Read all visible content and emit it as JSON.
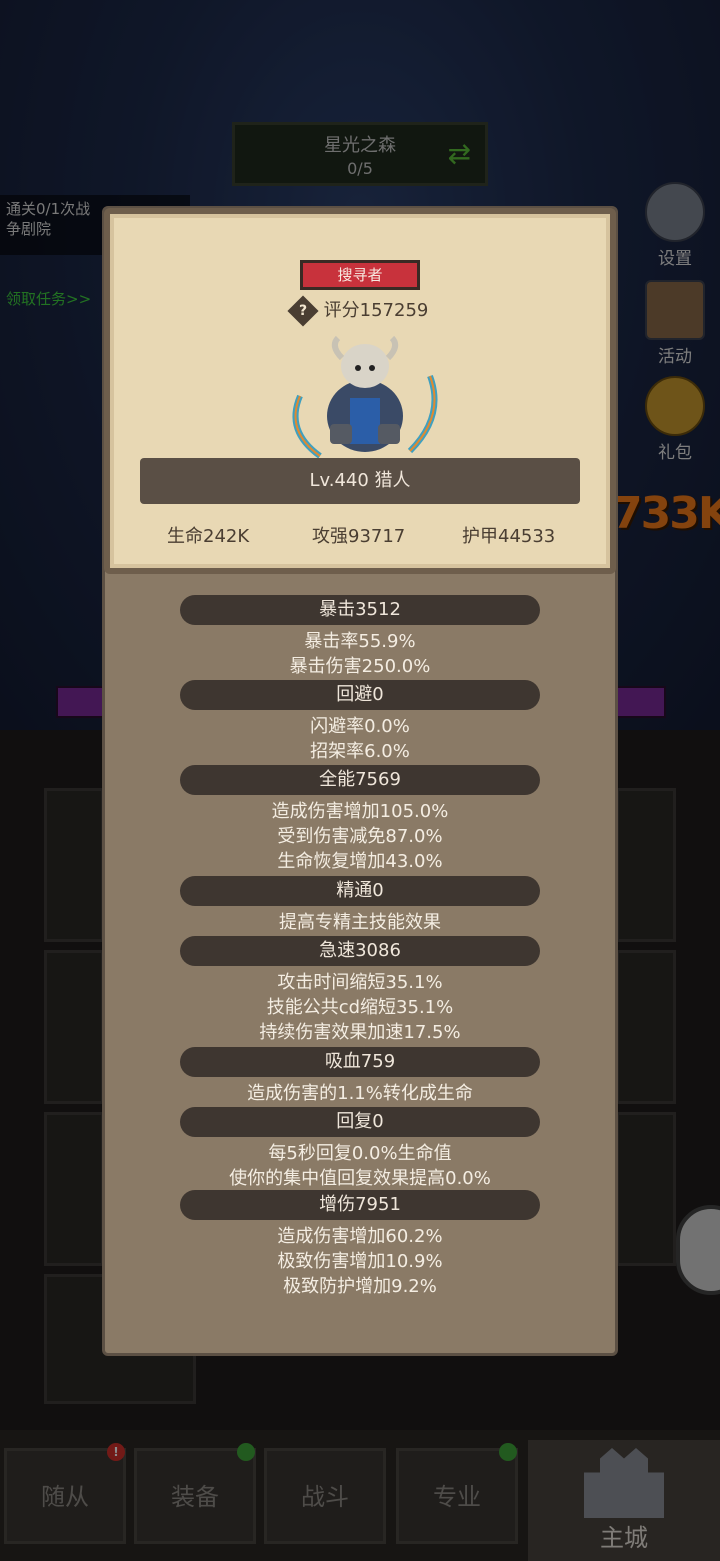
{
  "level": {
    "name": "星光之森",
    "progress": "0/5"
  },
  "quest": {
    "line1": "通关0/1次战",
    "line2": "争剧院",
    "claim": "领取任务>>"
  },
  "side": {
    "settings": "设置",
    "activity": "活动",
    "gift": "礼包"
  },
  "damage_popup": "733K",
  "hero": {
    "class_badge": "搜寻者",
    "question": "?",
    "score": "评分157259",
    "level_name": "Lv.440 猎人",
    "hp": "生命242K",
    "atk": "攻强93717",
    "armor": "护甲44533"
  },
  "attributes": [
    {
      "head": "暴击3512",
      "lines": [
        "暴击率55.9%",
        "暴击伤害250.0%"
      ]
    },
    {
      "head": "回避0",
      "lines": [
        "闪避率0.0%",
        "招架率6.0%"
      ]
    },
    {
      "head": "全能7569",
      "lines": [
        "造成伤害增加105.0%",
        "受到伤害减免87.0%",
        "生命恢复增加43.0%"
      ]
    },
    {
      "head": "精通0",
      "lines": [
        "提高专精主技能效果"
      ]
    },
    {
      "head": "急速3086",
      "lines": [
        "攻击时间缩短35.1%",
        "技能公共cd缩短35.1%",
        "持续伤害效果加速17.5%"
      ]
    },
    {
      "head": "吸血759",
      "lines": [
        "造成伤害的1.1%转化成生命"
      ]
    },
    {
      "head": "回复0",
      "lines": [
        "每5秒回复0.0%生命值",
        "使你的集中值回复效果提高0.0%"
      ]
    },
    {
      "head": "增伤7951",
      "lines": [
        "造成伤害增加60.2%",
        "极致伤害增加10.9%",
        "极致防护增加9.2%"
      ]
    }
  ],
  "tabs": [
    {
      "label": "随从",
      "dot": "!"
    },
    {
      "label": "装备",
      "dot": ""
    },
    {
      "label": "战斗",
      "dot": ""
    },
    {
      "label": "专业",
      "dot": ""
    },
    {
      "label": "主城",
      "dot": ""
    }
  ],
  "colors": {
    "badge": "#c8323c",
    "card": "#e8d8b4",
    "panel": "#8a7a66",
    "alert_dot": "#d0302a",
    "ok_dot": "#3fa53a"
  }
}
